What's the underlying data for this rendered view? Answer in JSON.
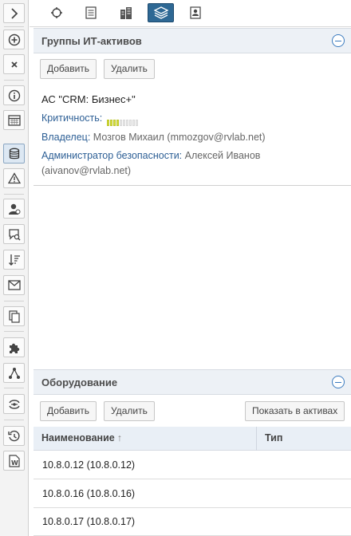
{
  "left_toolbar": {
    "icons": [
      "expand-chevron-icon",
      "add-circle-icon",
      "close-x-icon",
      "info-icon",
      "calendar-grid-icon",
      "database-icon",
      "warning-icon",
      "user-icon",
      "search-comment-icon",
      "sort-down-icon",
      "envelope-icon",
      "copy-icon",
      "puzzle-icon",
      "graph-nodes-icon",
      "link-toggle-icon",
      "history-icon",
      "word-document-icon"
    ],
    "active": "database-icon"
  },
  "top_tabs": {
    "icons": [
      "refresh-cycle-icon",
      "document-list-icon",
      "building-icon",
      "layers-icon",
      "contact-card-icon"
    ],
    "active_index": 3
  },
  "it_asset_groups": {
    "title": "Группы ИТ-активов",
    "add_label": "Добавить",
    "delete_label": "Удалить",
    "asset": {
      "name": "АС \"CRM: Бизнес+\"",
      "criticality_label": "Критичность:",
      "criticality_segments_filled": 4,
      "criticality_segments_total": 10,
      "owner_label": "Владелец:",
      "owner_value": "Мозгов Михаил (mmozgov@rvlab.net)",
      "security_admin_label": "Администратор безопасности:",
      "security_admin_value_1": "Алексей Иванов",
      "security_admin_value_2": "(aivanov@rvlab.net)"
    }
  },
  "equipment": {
    "title": "Оборудование",
    "add_label": "Добавить",
    "delete_label": "Удалить",
    "show_in_assets_label": "Показать в активах",
    "columns": {
      "name": "Наименование",
      "sort_arrow": "↑",
      "type": "Тип"
    },
    "rows": [
      "10.8.0.12 (10.8.0.12)",
      "10.8.0.16 (10.8.0.16)",
      "10.8.0.17 (10.8.0.17)"
    ]
  },
  "colors": {
    "accent": "#2e6894",
    "label_blue": "#2d5f95",
    "panel_header": "#edf1f6",
    "criticality": "#d6e03a"
  }
}
